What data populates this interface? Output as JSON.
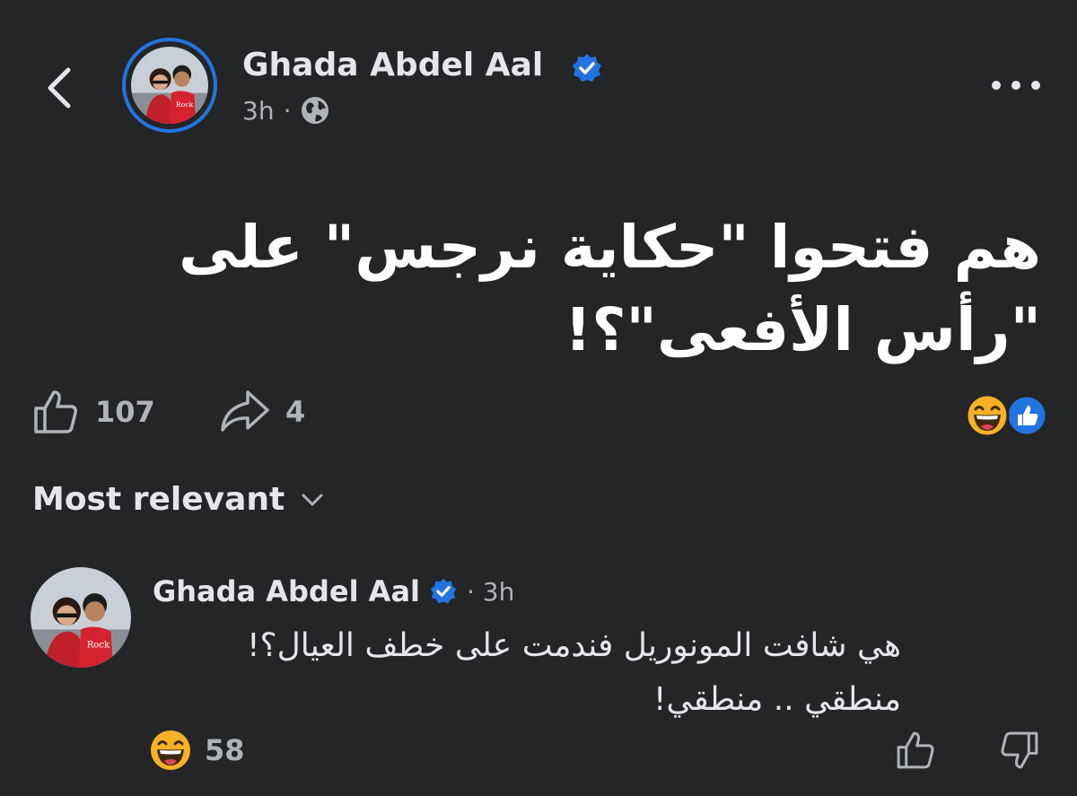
{
  "post": {
    "author": "Ghada Abdel Aal",
    "time": "3h",
    "separator": "·",
    "text_line1": "هم فتحوا \"حكاية نرجس\" على",
    "text_line2": "\"رأس الأفعى\"؟!",
    "likes": "107",
    "shares": "4",
    "reactions": [
      "haha",
      "like"
    ]
  },
  "sort": {
    "label": "Most relevant"
  },
  "comment": {
    "author": "Ghada Abdel Aal",
    "time": "· 3h",
    "text_line1": "هي شافت المونوريل فندمت على خطف العيال؟!",
    "text_line2": "منطقي .. منطقي!",
    "reaction_count": "58"
  },
  "icons": {
    "back": "chevron-left-icon",
    "more": "more-dots-icon",
    "verified": "verified-badge-icon",
    "privacy": "globe-icon",
    "like": "thumbs-up-icon",
    "share": "share-arrow-icon",
    "sort": "chevron-down-icon",
    "dislike": "thumbs-down-icon"
  },
  "colors": {
    "background": "#242526",
    "accent": "#2374e1",
    "text": "#e4e6eb",
    "muted": "#b0b3b8",
    "haha": "#f7b125"
  }
}
